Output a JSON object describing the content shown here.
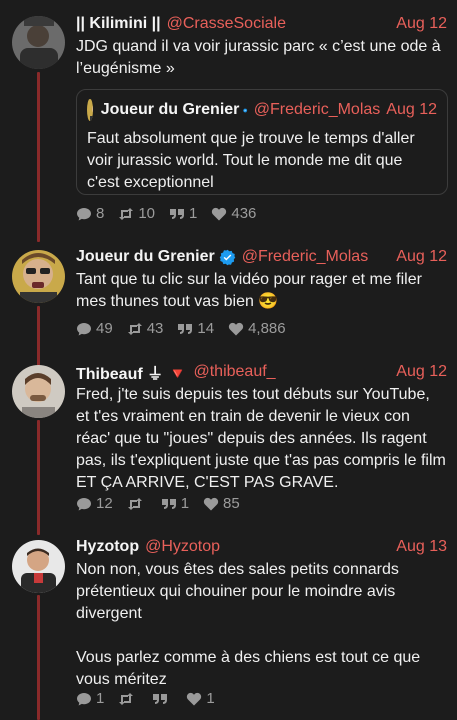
{
  "tweets": [
    {
      "name": "|| Kilimini ||",
      "handle": "@CrasseSociale",
      "date": "Aug 12",
      "text": "JDG quand il va voir jurassic parc « c’est une ode à l’eugénisme »",
      "quote": {
        "name": "Joueur du Grenier",
        "handle": "@Frederic_Molas",
        "date": "Aug 12",
        "text": "Faut absolument que je trouve le temps d'aller voir jurassic world. Tout le monde me dit que c'est exceptionnel"
      },
      "replies": "8",
      "retweets": "10",
      "quotes": "1",
      "likes": "436"
    },
    {
      "name": "Joueur du Grenier",
      "handle": "@Frederic_Molas",
      "date": "Aug 12",
      "text": "Tant que tu clic sur la vidéo pour rager et me filer mes thunes tout vas bien 😎",
      "replies": "49",
      "retweets": "43",
      "quotes": "14",
      "likes": "4,886"
    },
    {
      "name": "Thibeauf ⏚ 🔻",
      "handle": "@thibeauf_",
      "date": "Aug 12",
      "text": "Fred, j'te suis depuis tes tout débuts sur YouTube, et t'es vraiment en train de devenir le vieux con réac' que tu \"joues\" depuis des années. Ils ragent pas, ils t'expliquent juste que t'as pas compris le film ET ÇA ARRIVE, C'EST PAS GRAVE.",
      "replies": "12",
      "retweets": "",
      "quotes": "1",
      "likes": "85"
    },
    {
      "name": "Hyzotop",
      "handle": "@Hyzotop",
      "date": "Aug 13",
      "text": "Non non, vous êtes des sales petits connards prétentieux qui chouiner pour le moindre avis divergent",
      "text2": "Vous parlez comme à des chiens est tout ce que vous méritez",
      "replies": "1",
      "retweets": "",
      "quotes": "",
      "likes": "1"
    }
  ],
  "colors": {
    "background": "#1c1c1c",
    "accent": "#e8605a",
    "thread": "#8a2a2a",
    "muted": "#9a9a9a",
    "verified": "#1d9bf0"
  },
  "icons": [
    "reply-icon",
    "retweet-icon",
    "quote-icon",
    "like-icon",
    "verified-icon"
  ]
}
